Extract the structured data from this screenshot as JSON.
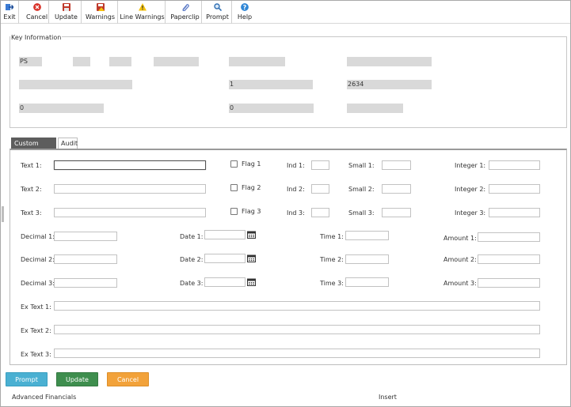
{
  "toolbar": {
    "buttons": [
      {
        "label": "Exit",
        "icon": "exit-icon"
      },
      {
        "label": "Cancel",
        "icon": "cancel-icon"
      },
      {
        "label": "Update",
        "icon": "save-icon"
      },
      {
        "label": "Warnings",
        "icon": "warnings-icon"
      },
      {
        "label": "Line Warnings",
        "icon": "warning-triangle-icon"
      },
      {
        "label": "Paperclip",
        "icon": "paperclip-icon"
      },
      {
        "label": "Prompt",
        "icon": "magnifier-icon"
      },
      {
        "label": "Help",
        "icon": "help-icon"
      }
    ]
  },
  "key_information": {
    "legend": "Key Information",
    "fields": [
      "PS",
      "",
      "",
      "",
      "",
      "",
      "",
      "1",
      "2634",
      "0",
      "0",
      ""
    ]
  },
  "tabs": [
    "Custom Fields",
    "Audit"
  ],
  "custom_fields": {
    "text_labels": [
      "Text 1:",
      "Text 2:",
      "Text 3:"
    ],
    "flag_labels": [
      "Flag 1",
      "Flag 2",
      "Flag 3"
    ],
    "ind_labels": [
      "Ind 1:",
      "Ind 2:",
      "Ind 3:"
    ],
    "small_labels": [
      "Small 1:",
      "Small 2:",
      "Small 3:"
    ],
    "integer_labels": [
      "Integer 1:",
      "Integer 2:",
      "Integer 3:"
    ],
    "decimal_labels": [
      "Decimal 1:",
      "Decimal 2:",
      "Decimal 3:"
    ],
    "date_labels": [
      "Date 1:",
      "Date 2:",
      "Date 3:"
    ],
    "time_labels": [
      "Time 1:",
      "Time 2:",
      "Time 3:"
    ],
    "amount_labels": [
      "Amount 1:",
      "Amount 2:",
      "Amount 3:"
    ],
    "ex_text_labels": [
      "Ex Text 1:",
      "Ex Text 2:",
      "Ex Text 3:"
    ]
  },
  "actions": {
    "prompt": "Prompt",
    "update": "Update",
    "cancel": "Cancel"
  },
  "footer": {
    "left": "Advanced Financials",
    "right": "Insert"
  }
}
